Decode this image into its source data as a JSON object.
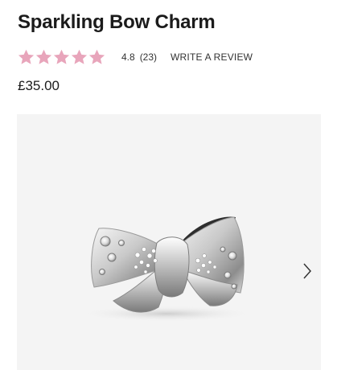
{
  "product": {
    "title": "Sparkling Bow Charm",
    "price": "£35.00"
  },
  "rating": {
    "value": "4.8",
    "count": "(23)",
    "stars": 5,
    "star_color": "#e8a5bb",
    "write_review_label": "WRITE A REVIEW"
  },
  "gallery": {
    "background": "#f4f4f4",
    "image_alt": "sparkling-bow-charm-image",
    "next_icon": "chevron-right-icon"
  }
}
